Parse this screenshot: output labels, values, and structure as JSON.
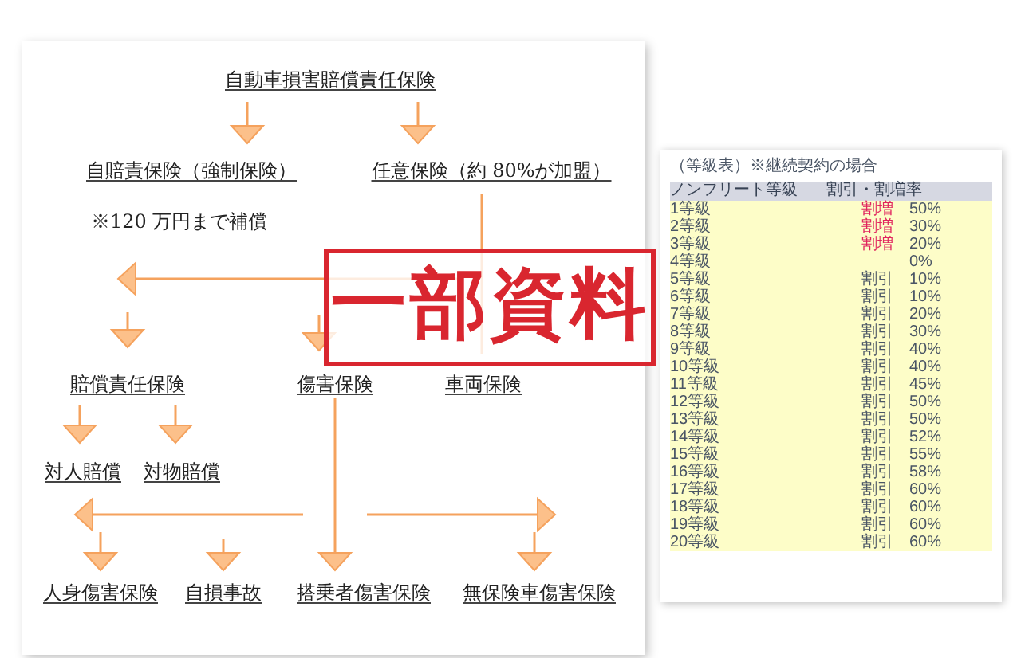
{
  "flowchart": {
    "nodes": [
      {
        "label": "自動車損害賠償責任保険",
        "kind": "node"
      },
      {
        "label": "自賠責保険（強制保険）",
        "kind": "node"
      },
      {
        "label": "任意保険（約 80%が加盟）",
        "kind": "node"
      },
      {
        "label": "※120 万円まで補償",
        "kind": "note"
      },
      {
        "label": "賠償責任保険",
        "kind": "node"
      },
      {
        "label": "傷害保険",
        "kind": "node"
      },
      {
        "label": "車両保険",
        "kind": "node"
      },
      {
        "label": "対人賠償",
        "kind": "node"
      },
      {
        "label": "対物賠償",
        "kind": "node"
      },
      {
        "label": "人身傷害保険",
        "kind": "node"
      },
      {
        "label": "自損事故",
        "kind": "node"
      },
      {
        "label": "搭乗者傷害保険",
        "kind": "node"
      },
      {
        "label": "無保険車傷害保険",
        "kind": "node"
      }
    ]
  },
  "stamp": {
    "text": "一部資料"
  },
  "grade_table": {
    "title": "（等級表）※継続契約の場合",
    "columns": [
      "ノンフリート等級",
      "割引・割増率"
    ],
    "rows": [
      {
        "grade": "1等級",
        "type": "割増",
        "rate": "50%",
        "kind": "surcharge"
      },
      {
        "grade": "2等級",
        "type": "割増",
        "rate": "30%",
        "kind": "surcharge"
      },
      {
        "grade": "3等級",
        "type": "割増",
        "rate": "20%",
        "kind": "surcharge"
      },
      {
        "grade": "4等級",
        "rate": "0%",
        "kind": "none"
      },
      {
        "grade": "5等級",
        "type": "割引",
        "rate": "10%",
        "kind": "discount"
      },
      {
        "grade": "6等級",
        "type": "割引",
        "rate": "10%",
        "kind": "discount"
      },
      {
        "grade": "7等級",
        "type": "割引",
        "rate": "20%",
        "kind": "discount"
      },
      {
        "grade": "8等級",
        "type": "割引",
        "rate": "30%",
        "kind": "discount"
      },
      {
        "grade": "9等級",
        "type": "割引",
        "rate": "40%",
        "kind": "discount"
      },
      {
        "grade": "10等級",
        "type": "割引",
        "rate": "40%",
        "kind": "discount"
      },
      {
        "grade": "11等級",
        "type": "割引",
        "rate": "45%",
        "kind": "discount"
      },
      {
        "grade": "12等級",
        "type": "割引",
        "rate": "50%",
        "kind": "discount"
      },
      {
        "grade": "13等級",
        "type": "割引",
        "rate": "50%",
        "kind": "discount"
      },
      {
        "grade": "14等級",
        "type": "割引",
        "rate": "52%",
        "kind": "discount"
      },
      {
        "grade": "15等級",
        "type": "割引",
        "rate": "55%",
        "kind": "discount"
      },
      {
        "grade": "16等級",
        "type": "割引",
        "rate": "58%",
        "kind": "discount"
      },
      {
        "grade": "17等級",
        "type": "割引",
        "rate": "60%",
        "kind": "discount"
      },
      {
        "grade": "18等級",
        "type": "割引",
        "rate": "60%",
        "kind": "discount"
      },
      {
        "grade": "19等級",
        "type": "割引",
        "rate": "60%",
        "kind": "discount"
      },
      {
        "grade": "20等級",
        "type": "割引",
        "rate": "60%",
        "kind": "discount"
      }
    ]
  }
}
